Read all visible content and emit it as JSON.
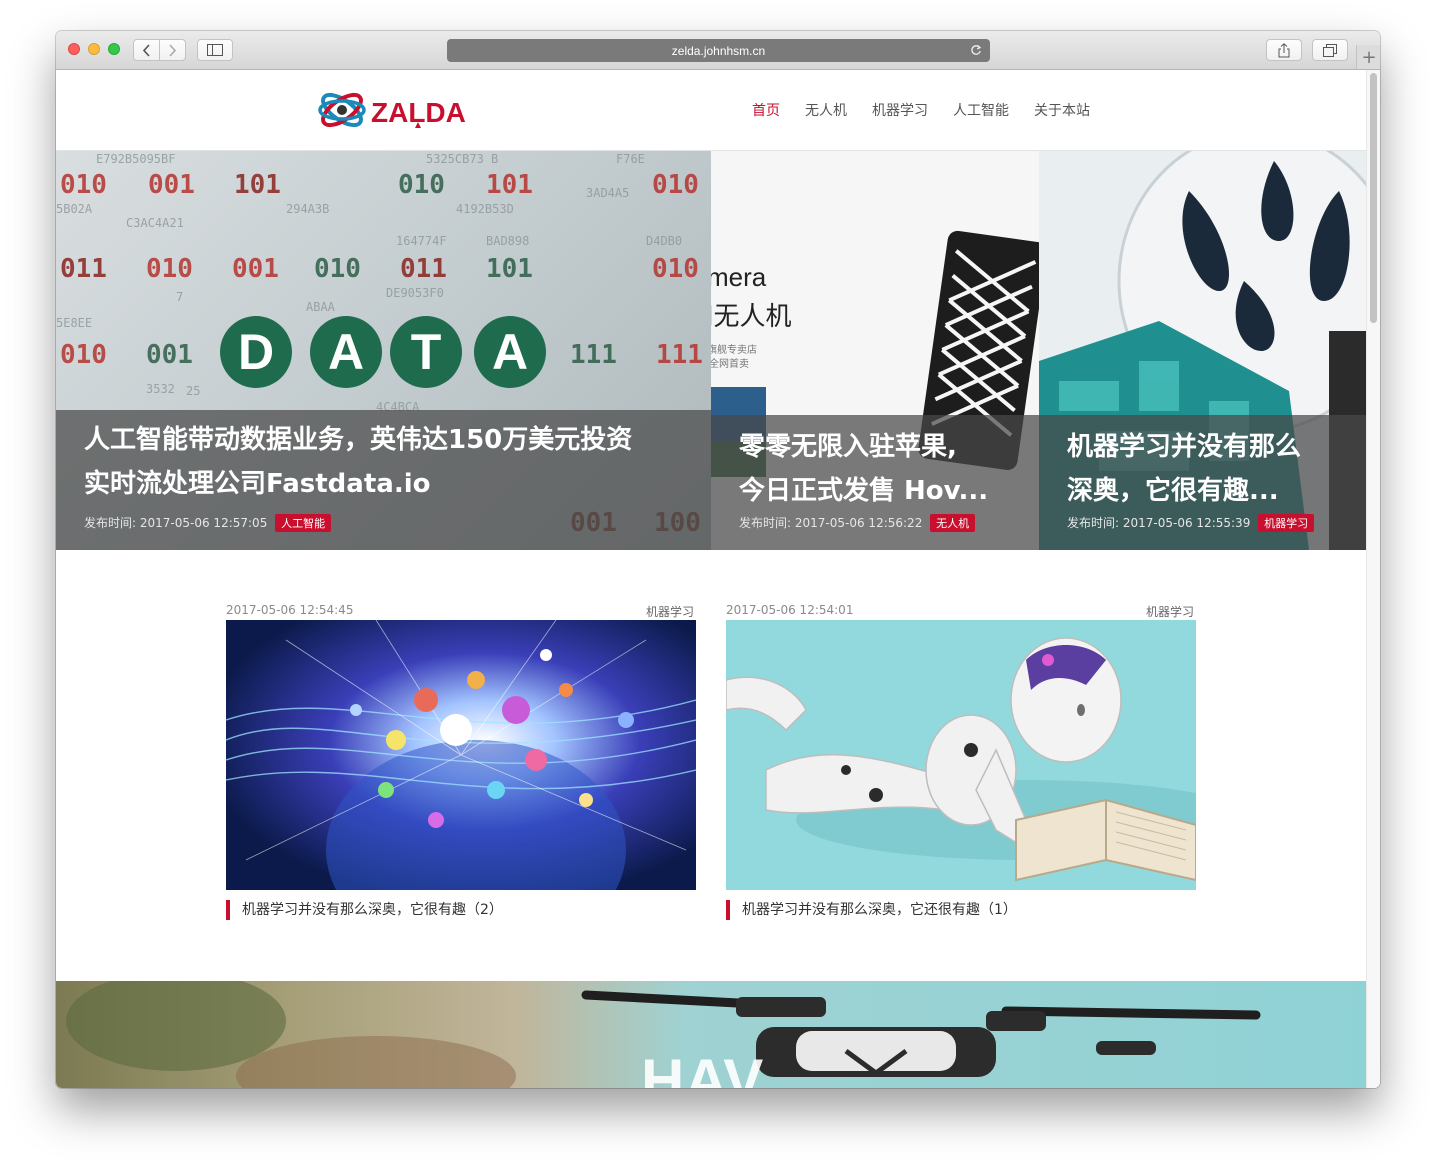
{
  "browser": {
    "url": "zelda.johnhsm.cn"
  },
  "site": {
    "logo_text": "ZALDA",
    "nav": [
      {
        "label": "首页",
        "active": true
      },
      {
        "label": "无人机",
        "active": false
      },
      {
        "label": "机器学习",
        "active": false
      },
      {
        "label": "人工智能",
        "active": false
      },
      {
        "label": "关于本站",
        "active": false
      }
    ]
  },
  "slides": [
    {
      "title_line1": "人工智能带动数据业务，英伟达150万美元投资",
      "title_line2": "实时流处理公司Fastdata.io",
      "meta_label": "发布时间:",
      "time": "2017-05-06 12:57:05",
      "category": "人工智能",
      "image": "data-binary-image"
    },
    {
      "title_line1": "零零无限入驻苹果,",
      "title_line2": "今日正式发售 Hov...",
      "meta_label": "发布时间:",
      "time": "2017-05-06 12:56:22",
      "category": "无人机",
      "image": "drone-camera-image",
      "image_text": [
        "mera",
        "d无人机",
        "旗舰专卖店",
        "全网首卖"
      ]
    },
    {
      "title_line1": "机器学习并没有那么",
      "title_line2": "深奥，它很有趣...",
      "meta_label": "发布时间:",
      "time": "2017-05-06 12:55:39",
      "category": "机器学习",
      "image": "robot-image"
    }
  ],
  "posts": [
    {
      "time": "2017-05-06 12:54:45",
      "category": "机器学习",
      "title": "机器学习并没有那么深奥，它很有趣（2）",
      "image": "neural-head-image"
    },
    {
      "time": "2017-05-06 12:54:01",
      "category": "机器学习",
      "title": "机器学习并没有那么深奥，它还很有趣（1）",
      "image": "reading-robot-image"
    }
  ],
  "banner": {
    "image": "drone-banner-image"
  },
  "colors": {
    "accent": "#c8102e",
    "overlay": "#484848",
    "text": "#333333"
  }
}
